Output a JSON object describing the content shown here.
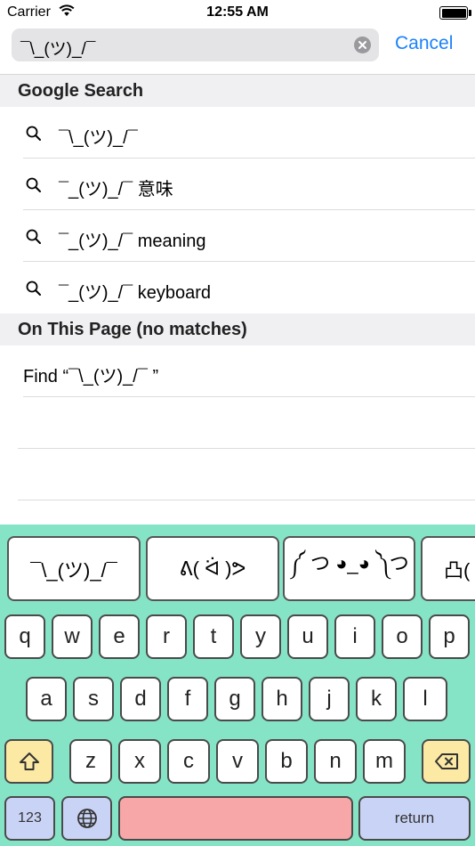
{
  "status": {
    "carrier": "Carrier",
    "time": "12:55 AM"
  },
  "search": {
    "query": "¯\\_(ツ)_/¯",
    "cancel": "Cancel"
  },
  "sections": {
    "google": "Google Search",
    "page": "On This Page (no matches)"
  },
  "suggestions": [
    "¯\\_(ツ)_/¯",
    "¯_(ツ)_/¯ 意味",
    "¯_(ツ)_/¯ meaning",
    "¯_(ツ)_/¯ keyboard"
  ],
  "find_text": "Find “¯\\_(ツ)_/¯ ”",
  "keyboard": {
    "emoji": [
      "¯\\_(ツ)_/¯",
      "ᕕ( ᐛ )ᕗ",
      "༼ つ ◕_◕ ༽つ",
      "凸("
    ],
    "row1": [
      "q",
      "w",
      "e",
      "r",
      "t",
      "y",
      "u",
      "i",
      "o",
      "p"
    ],
    "row2": [
      "a",
      "s",
      "d",
      "f",
      "g",
      "h",
      "j",
      "k",
      "l"
    ],
    "row3": [
      "z",
      "x",
      "c",
      "v",
      "b",
      "n",
      "m"
    ],
    "mode": "123",
    "return": "return",
    "colors": {
      "background": "#86e4c6",
      "space": "#f8a7a9",
      "shift": "#fbe9a4",
      "function": "#c9d3f5"
    }
  },
  "icons": {
    "search": "magnifier-icon",
    "clear": "clear-icon",
    "shift": "shift-icon",
    "backspace": "backspace-icon",
    "globe": "globe-icon",
    "wifi": "wifi-icon",
    "battery": "battery-icon"
  }
}
